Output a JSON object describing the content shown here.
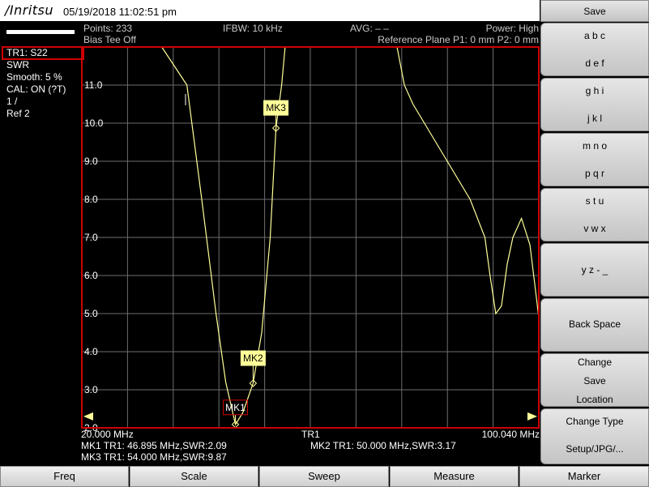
{
  "header": {
    "logo": "/Inritsu",
    "timestamp": "05/19/2018 11:02:51 pm",
    "points": "Points: 233",
    "ifbw": "IFBW: 10 kHz",
    "avg": "AVG: – –",
    "power": "Power: High",
    "bias_tee": "Bias Tee Off",
    "ref_plane": "Reference Plane P1: 0 mm P2: 0 mm"
  },
  "trace_info": {
    "label": "TR1: S22",
    "format": "SWR",
    "smooth": "Smooth: 5 %",
    "cal": "CAL: ON (?T)",
    "scale": "1 /",
    "ref": "Ref 2"
  },
  "y_labels": [
    "11.0",
    "10.0",
    "9.0",
    "8.0",
    "7.0",
    "6.0",
    "5.0",
    "4.0",
    "3.0",
    "2.0"
  ],
  "x_axis": {
    "start": "20.000 MHz",
    "trace": "TR1",
    "stop": "100.040 MHz"
  },
  "markers": {
    "mk1_label": "MK1",
    "mk2_label": "MK2",
    "mk3_label": "MK3",
    "mk1": "MK1 TR1:  46.895 MHz,SWR:2.09",
    "mk2": "MK2 TR1:  50.000 MHz,SWR:3.17",
    "mk3": "MK3 TR1:  54.000 MHz,SWR:9.87"
  },
  "chart_data": {
    "type": "line",
    "x_range_mhz": [
      20.0,
      100.04
    ],
    "ylim": [
      2,
      12
    ],
    "grid": true,
    "series": [
      {
        "x": [
          20.0,
          34.0,
          38.4,
          41.0,
          43.5,
          45.2,
          46.9,
          48.2,
          50.0,
          51.5,
          53.0,
          54.0,
          55.0,
          55.6,
          75.2,
          76.5,
          78.0,
          80.0,
          84.0,
          88.0,
          90.6,
          91.5,
          92.5,
          93.5,
          94.5,
          95.5,
          97.0,
          98.5,
          100.04
        ],
        "y": [
          12,
          12,
          11.0,
          8.0,
          5.0,
          3.2,
          2.09,
          2.4,
          3.17,
          4.5,
          7.0,
          9.87,
          11.0,
          12,
          12,
          11.0,
          10.5,
          10.0,
          9.0,
          8.0,
          7.0,
          6.0,
          5.0,
          5.2,
          6.3,
          7.0,
          7.5,
          6.8,
          4.9
        ]
      }
    ],
    "markers": [
      {
        "name": "MK1",
        "x": 46.895,
        "y": 2.09
      },
      {
        "name": "MK2",
        "x": 50.0,
        "y": 3.17
      },
      {
        "name": "MK3",
        "x": 54.0,
        "y": 9.87
      }
    ]
  },
  "softkeys": {
    "save": "Save",
    "abc": "a b c",
    "def": "d e f",
    "ghi": "g h i",
    "jkl": "j k l",
    "mno": "m n o",
    "pqr": "p q r",
    "stu": "s t u",
    "vwx": "v w x",
    "yz": "y z - _",
    "backspace": "Back Space",
    "change_save_1": "Change",
    "change_save_2": "Save",
    "change_save_3": "Location",
    "change_type_1": "Change Type",
    "change_type_2": "Setup/JPG/..."
  },
  "tabs": [
    "Freq",
    "Scale",
    "Sweep",
    "Measure",
    "Marker"
  ],
  "colors": {
    "trace": "#ffff99",
    "grid": "#6e6e6e",
    "border": "#d00000"
  }
}
